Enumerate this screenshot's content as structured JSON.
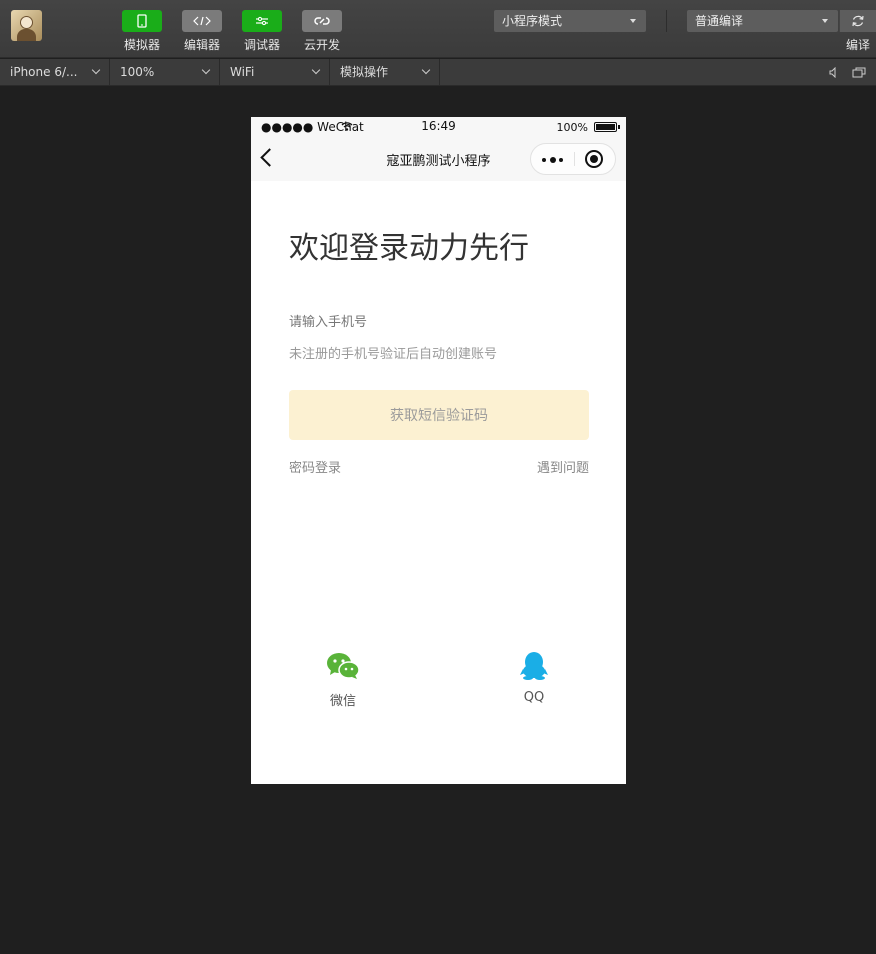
{
  "toolbar": {
    "buttons": [
      {
        "label": "模拟器",
        "icon": "phone-icon"
      },
      {
        "label": "编辑器",
        "icon": "code-icon"
      },
      {
        "label": "调试器",
        "icon": "debug-icon"
      },
      {
        "label": "云开发",
        "icon": "cloud-link-icon"
      }
    ],
    "mode_select": "小程序模式",
    "compile_select": "普通编译",
    "compile_label": "编译"
  },
  "simulator_bar": {
    "device": "iPhone 6/...",
    "zoom": "100%",
    "network": "WiFi",
    "operation": "模拟操作"
  },
  "phone": {
    "status": {
      "carrier": "●●●●● WeChat",
      "time": "16:49",
      "battery": "100%"
    },
    "nav_title": "寇亚鹏测试小程序",
    "welcome_title": "欢迎登录动力先行",
    "phone_placeholder": "请输入手机号",
    "hint": "未注册的手机号验证后自动创建账号",
    "sms_button": "获取短信验证码",
    "password_login": "密码登录",
    "problem": "遇到问题",
    "social": [
      {
        "label": "微信",
        "icon": "wechat-icon",
        "color": "#59b339"
      },
      {
        "label": "QQ",
        "icon": "qq-icon",
        "color": "#1aaee6"
      }
    ]
  },
  "colors": {
    "sms_button_bg": "#fcf1d2",
    "toolbar_green": "#1aad19"
  }
}
